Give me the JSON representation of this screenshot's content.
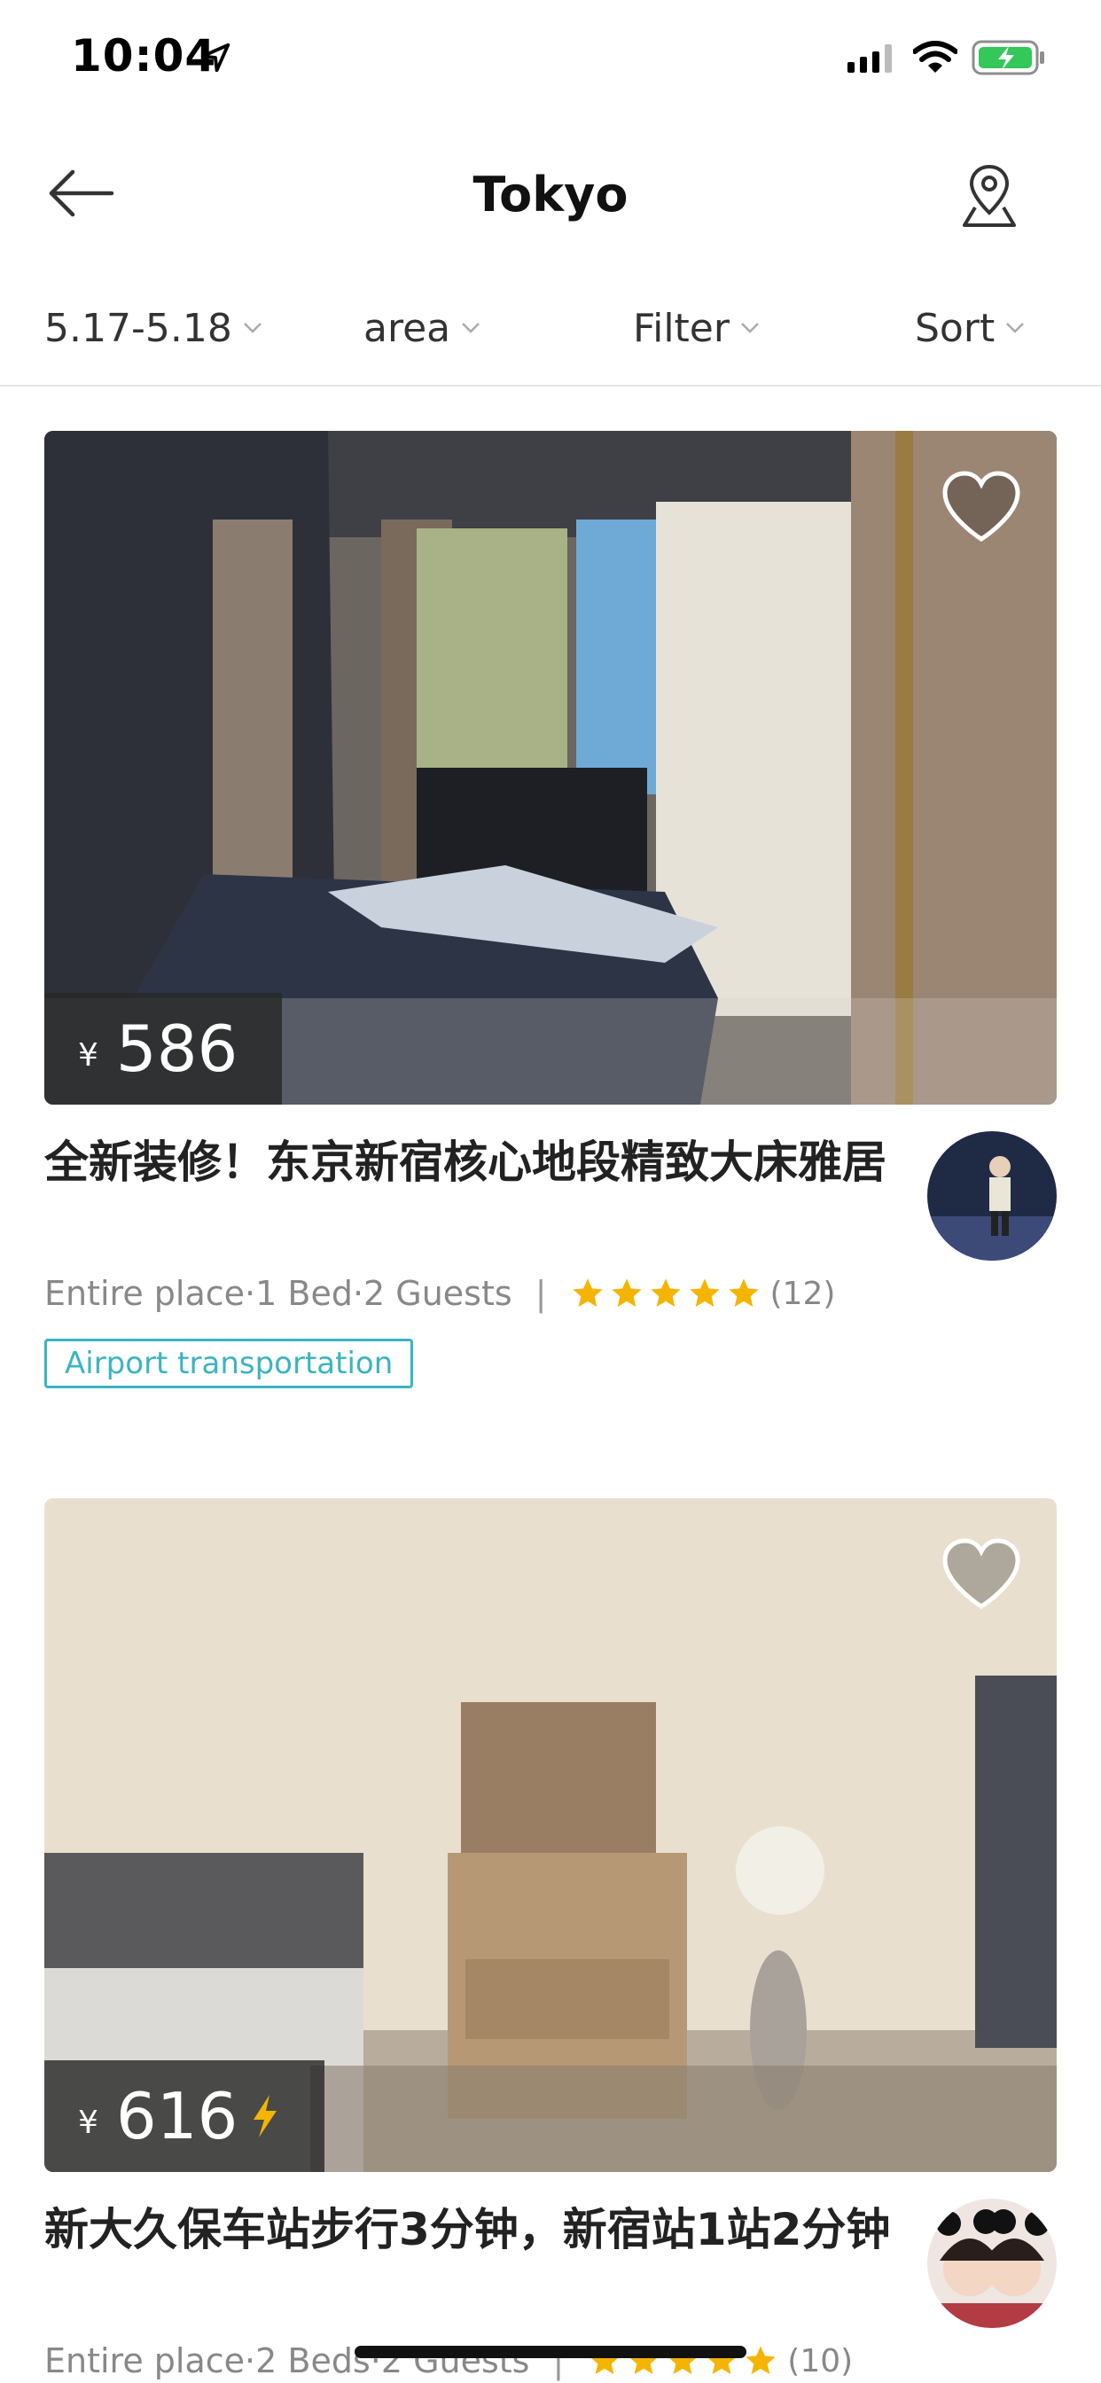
{
  "status_bar": {
    "time": "10:04"
  },
  "nav": {
    "title": "Tokyo"
  },
  "filters": {
    "date": "5.17-5.18",
    "area": "area",
    "filter": "Filter",
    "sort": "Sort"
  },
  "listings": [
    {
      "price_currency": "¥",
      "price": "586",
      "instant_book": false,
      "title": "全新装修！东京新宿核心地段精致大床雅居",
      "details": "Entire place·1 Bed·2 Guests",
      "rating_stars": 5,
      "review_count": "(12)",
      "tag": "Airport transportation"
    },
    {
      "price_currency": "¥",
      "price": "616",
      "instant_book": true,
      "title": "新大久保车站步行3分钟，新宿站1站2分钟",
      "details": "Entire place·2 Beds·2 Guests",
      "rating_stars": 5,
      "review_count": "(10)"
    }
  ],
  "colors": {
    "accent": "#3bb4c1",
    "star": "#f5b400",
    "bolt": "#f5b400"
  }
}
